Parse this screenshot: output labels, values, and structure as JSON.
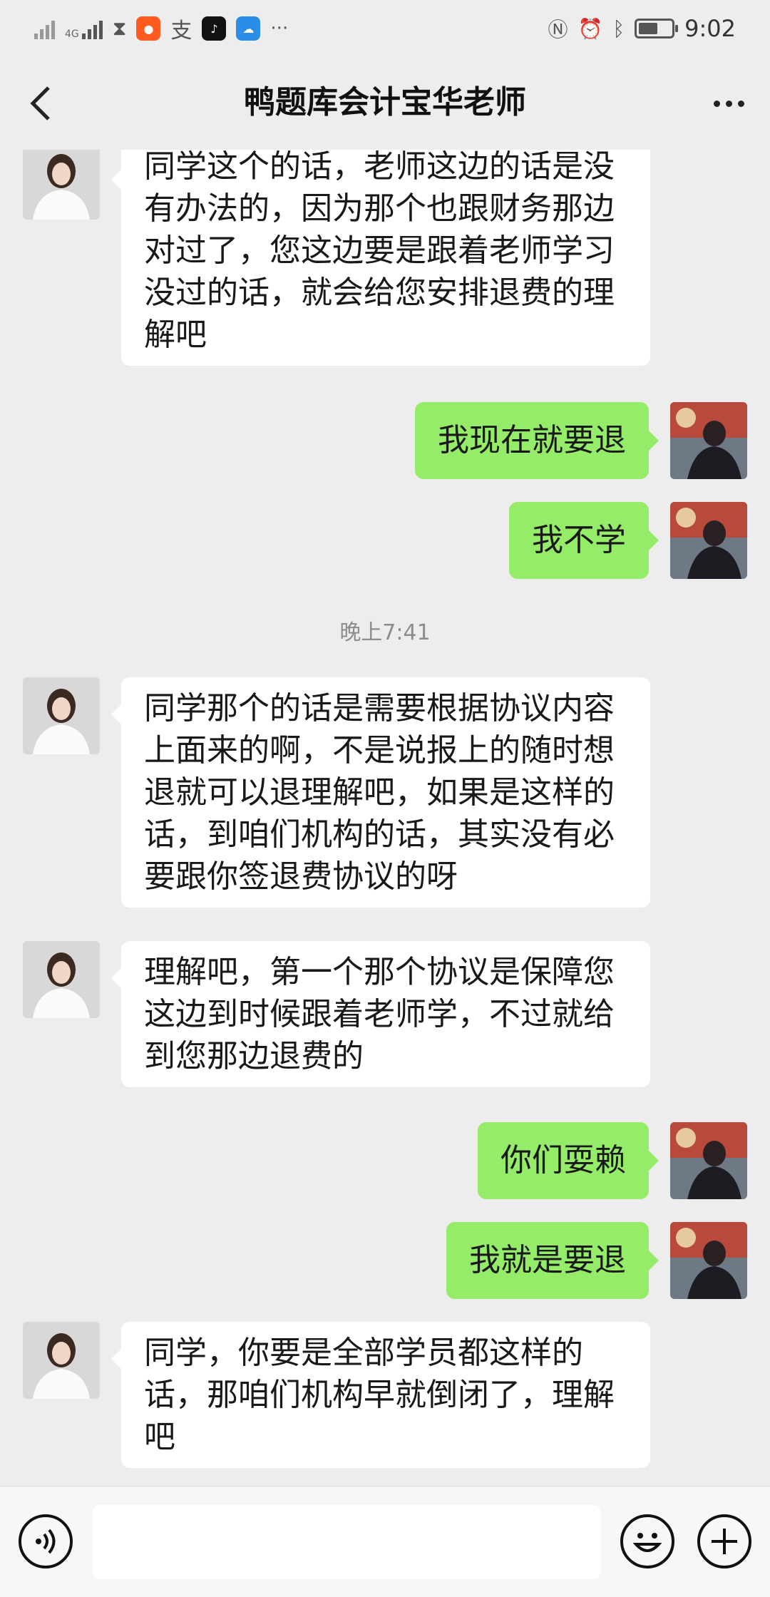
{
  "status_bar": {
    "network_label": "4G",
    "time": "9:02",
    "battery_level": 0.6,
    "icons": [
      "signal-icon",
      "signal-4g-icon",
      "hourglass-icon",
      "taobao-app-icon",
      "alipay-icon",
      "tiktok-icon",
      "weather-app-icon",
      "more-notifications-icon",
      "nfc-icon",
      "alarm-icon",
      "bluetooth-icon",
      "battery-icon"
    ]
  },
  "header": {
    "title": "鸭题库会计宝华老师",
    "back_icon": "chevron-left-icon",
    "more_icon": "more-dots-icon"
  },
  "messages": [
    {
      "from": "teacher",
      "text": "同学这个的话，老师这边的话是没有办法的，因为那个也跟财务那边对过了，您这边要是跟着老师学习没过的话，就会给您安排退费的理解吧"
    },
    {
      "from": "me",
      "text": "我现在就要退"
    },
    {
      "from": "me",
      "text": "我不学"
    },
    {
      "type": "time",
      "text": "晚上7:41"
    },
    {
      "from": "teacher",
      "text": "同学那个的话是需要根据协议内容上面来的啊，不是说报上的随时想退就可以退理解吧，如果是这样的话，到咱们机构的话，其实没有必要跟你签退费协议的呀"
    },
    {
      "from": "teacher",
      "text": "理解吧，第一个那个协议是保障您这边到时候跟着老师学，不过就给到您那边退费的"
    },
    {
      "from": "me",
      "text": "你们耍赖"
    },
    {
      "from": "me",
      "text": "我就是要退"
    },
    {
      "from": "teacher",
      "text": "同学，你要是全部学员都这样的话，那咱们机构早就倒闭了，理解吧"
    }
  ],
  "input_bar": {
    "draft": "",
    "voice_icon": "voice-input-icon",
    "emoji_icon": "emoji-icon",
    "plus_icon": "plus-icon"
  },
  "colors": {
    "background": "#ededed",
    "outgoing_bubble": "#95ec69",
    "incoming_bubble": "#ffffff"
  }
}
